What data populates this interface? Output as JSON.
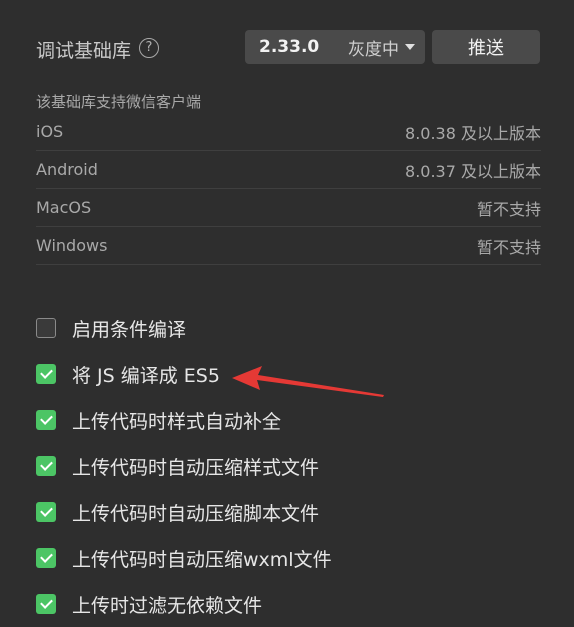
{
  "header": {
    "title": "调试基础库",
    "help_icon": "?",
    "version": "2.33.0",
    "channel": "灰度中",
    "push_label": "推送"
  },
  "support": {
    "title": "该基础库支持微信客户端",
    "rows": [
      {
        "client": "iOS",
        "support": "8.0.38 及以上版本"
      },
      {
        "client": "Android",
        "support": "8.0.37 及以上版本"
      },
      {
        "client": "MacOS",
        "support": "暂不支持"
      },
      {
        "client": "Windows",
        "support": "暂不支持"
      }
    ]
  },
  "options": [
    {
      "label": "启用条件编译",
      "checked": false
    },
    {
      "label": "将 JS 编译成 ES5",
      "checked": true
    },
    {
      "label": "上传代码时样式自动补全",
      "checked": true
    },
    {
      "label": "上传代码时自动压缩样式文件",
      "checked": true
    },
    {
      "label": "上传代码时自动压缩脚本文件",
      "checked": true
    },
    {
      "label": "上传代码时自动压缩wxml文件",
      "checked": true
    },
    {
      "label": "上传时过滤无依赖文件",
      "checked": true
    }
  ],
  "colors": {
    "accent": "#4cc565",
    "arrow": "#e53935",
    "background": "#2e2e2e"
  }
}
